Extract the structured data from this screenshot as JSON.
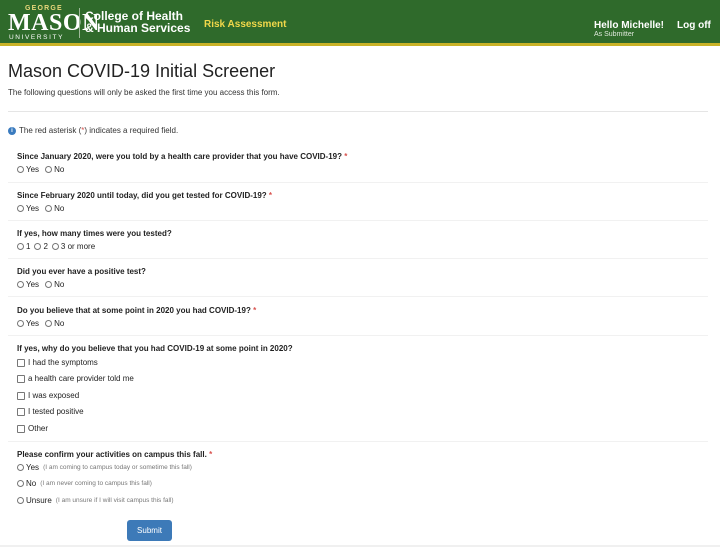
{
  "header": {
    "logo": {
      "top": "GEORGE",
      "main": "MASON",
      "bottom": "UNIVERSITY"
    },
    "college_line1": "College of Health",
    "college_line2": "& Human Services",
    "nav_link": "Risk Assessment",
    "greeting": "Hello Michelle!",
    "role": "As Submitter",
    "logoff": "Log off",
    "colors": {
      "bar": "#2f6a2b",
      "accent": "#c9b227",
      "nav_link": "#f2d84a"
    }
  },
  "page": {
    "title": "Mason COVID-19 Initial Screener",
    "subtitle": "The following questions will only be asked the first time you access this form.",
    "required_note_prefix": "The red asterisk (",
    "required_note_star": "*",
    "required_note_suffix": ") indicates a required field."
  },
  "questions": [
    {
      "label": "Since January 2020, were you told by a health care provider that you have COVID-19?",
      "required": "*",
      "options": [
        "Yes",
        "No"
      ]
    },
    {
      "label": "Since February 2020 until today, did you get tested for COVID-19?",
      "required": "*",
      "options": [
        "Yes",
        "No"
      ]
    },
    {
      "label": "If yes, how many times were you tested?",
      "required": "",
      "options": [
        "1",
        "2",
        "3 or more"
      ]
    },
    {
      "label": "Did you ever have a positive test?",
      "required": "",
      "options": [
        "Yes",
        "No"
      ]
    },
    {
      "label": "Do you believe that at some point in 2020 you had COVID-19?",
      "required": "*",
      "options": [
        "Yes",
        "No"
      ]
    },
    {
      "label": "If yes, why do you believe that you had COVID-19 at some point in 2020?",
      "required": "",
      "checkboxes": [
        "I had the symptoms",
        "a health care provider told me",
        "I was exposed",
        "I tested positive",
        "Other"
      ]
    },
    {
      "label": "Please confirm your activities on campus this fall.",
      "required": "*",
      "options": [
        {
          "label": "Yes",
          "hint": "(I am coming to campus today or sometime this fall)"
        },
        {
          "label": "No",
          "hint": "(I am never coming to campus this fall)"
        },
        {
          "label": "Unsure",
          "hint": "(I am unsure if I will visit campus this fall)"
        }
      ]
    }
  ],
  "submit_label": "Submit"
}
